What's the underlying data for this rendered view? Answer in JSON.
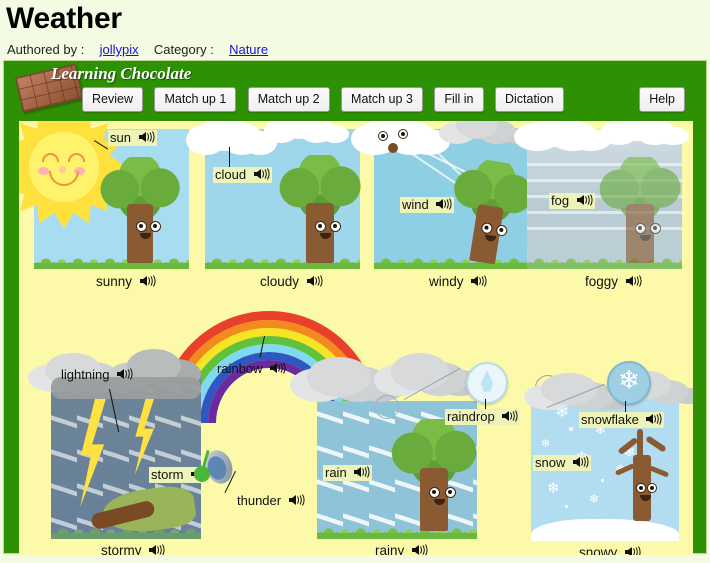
{
  "page": {
    "title": "Weather",
    "authored_by_label": "Authored by :",
    "author": "jollypix",
    "category_label": "Category :",
    "category": "Nature"
  },
  "brand": {
    "logo_text": "Learning Chocolate",
    "logo_icon": "chocolate-bar-icon"
  },
  "toolbar": {
    "buttons": [
      {
        "label": "Review"
      },
      {
        "label": "Match up 1"
      },
      {
        "label": "Match up 2"
      },
      {
        "label": "Match up 3"
      },
      {
        "label": "Fill in"
      },
      {
        "label": "Dictation"
      }
    ],
    "help_label": "Help"
  },
  "colors": {
    "frame_green": "#2e9104",
    "panel_yellow": "#fcf9a8",
    "page_background": "#f4fbe3",
    "label_highlight": "#eef3b8",
    "link_blue": "#1414cc",
    "sky_blue": "#a8dcf0",
    "storm_blue": "#67809a",
    "snow_blue": "#b2dcef"
  },
  "cards": [
    {
      "id": "sunny",
      "caption": "sunny",
      "labels": [
        {
          "text": "sun",
          "name": "label-sun"
        }
      ]
    },
    {
      "id": "cloudy",
      "caption": "cloudy",
      "labels": [
        {
          "text": "cloud",
          "name": "label-cloud"
        }
      ]
    },
    {
      "id": "windy",
      "caption": "windy",
      "labels": [
        {
          "text": "wind",
          "name": "label-wind"
        }
      ]
    },
    {
      "id": "foggy",
      "caption": "foggy",
      "labels": [
        {
          "text": "fog",
          "name": "label-fog"
        }
      ]
    },
    {
      "id": "stormy",
      "caption": "stormy",
      "labels": [
        {
          "text": "lightning",
          "name": "label-lightning"
        },
        {
          "text": "storm",
          "name": "label-storm"
        }
      ]
    },
    {
      "id": "rainy",
      "caption": "rainy",
      "labels": [
        {
          "text": "rain",
          "name": "label-rain"
        },
        {
          "text": "raindrop",
          "name": "label-raindrop"
        }
      ]
    },
    {
      "id": "snowy",
      "caption": "snowy",
      "labels": [
        {
          "text": "snow",
          "name": "label-snow"
        },
        {
          "text": "snowflake",
          "name": "label-snowflake"
        }
      ]
    }
  ],
  "extra_labels": [
    {
      "text": "rainbow",
      "name": "label-rainbow"
    },
    {
      "text": "thunder",
      "name": "label-thunder"
    }
  ],
  "audio_icon": "speaker-icon"
}
